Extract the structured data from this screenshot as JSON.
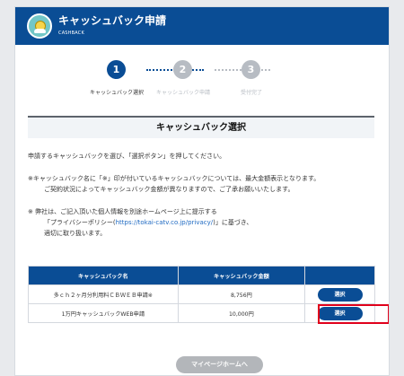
{
  "header": {
    "title": "キャッシュバック申請",
    "subtitle": "CASHBACK",
    "logo_icon": "cashback-hand-coin-icon"
  },
  "stepper": {
    "steps": [
      {
        "number": "1",
        "label": "キャッシュバック選択",
        "state": "active"
      },
      {
        "number": "2",
        "label": "キャッシュバック申請",
        "state": "inactive"
      },
      {
        "number": "3",
        "label": "受付完了",
        "state": "inactive"
      }
    ]
  },
  "main": {
    "section_title": "キャッシュバック選択",
    "instruction": "申請するキャッシュバックを選び、「選択ボタン」を押してください。",
    "note1": {
      "line1": "※キャッシュバック名に「※」印が付いているキャッシュバックについては、最大金額表示となります。",
      "line2": "ご契約状況によってキャッシュバック金額が異なりますので、ご了承お願いいたします。"
    },
    "note2": {
      "line1": "※ 弊社は、ご記入頂いた個人情報を別途ホームページ上に提示する",
      "line2_prefix": "「プライバシーポリシー(",
      "line2_link": "https://tokai-catv.co.jp/privacy/",
      "line2_suffix": ")」に基づき、",
      "line3": "適切に取り扱います。"
    }
  },
  "table": {
    "headers": [
      "キャッシュバック名",
      "キャッシュバック金額",
      ""
    ],
    "rows": [
      {
        "name": "多ｃｈ２ヶ月分利用料ＣＢＷＥＢ申請※",
        "amount": "8,756円",
        "button": "選択"
      },
      {
        "name": "1万円キャッシュバックWEB申請",
        "amount": "10,000円",
        "button": "選択"
      }
    ]
  },
  "footer": {
    "mypage_button": "マイページホームへ"
  },
  "colors": {
    "brand_blue": "#0a4d95",
    "inactive_gray": "#b7bcc3",
    "highlight_red": "#e0001b",
    "link_blue": "#1f6ac2"
  }
}
